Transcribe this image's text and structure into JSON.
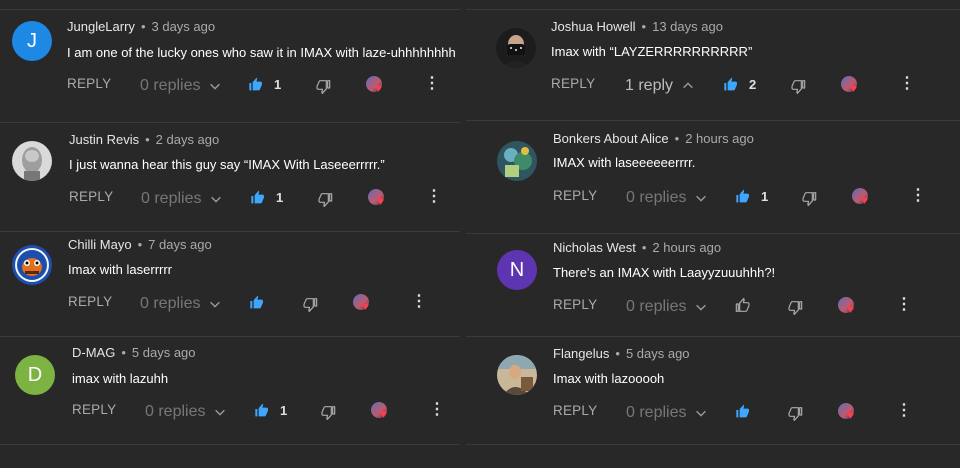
{
  "reply_label": "REPLY",
  "left_comments": [
    {
      "author": "JungleLarry",
      "time": "3 days ago",
      "text": "I am one of the lucky ones who saw it in IMAX with laze-uhhhhhhhh",
      "replies": "0 replies",
      "likes": "1",
      "avatar": {
        "type": "letter",
        "letter": "J",
        "color": "#1e88e5"
      }
    },
    {
      "author": "Justin Revis",
      "time": "2 days ago",
      "text": "I just wanna hear this guy say “IMAX With Laseeerrrrr.”",
      "replies": "0 replies",
      "likes": "1",
      "avatar": {
        "type": "image",
        "color": "#cfcfcf"
      }
    },
    {
      "author": "Chilli Mayo",
      "time": "7 days ago",
      "text": "Imax with laserrrrr",
      "replies": "0 replies",
      "likes": "",
      "avatar": {
        "type": "image",
        "color": "#1a4fb0"
      }
    },
    {
      "author": "D-MAG",
      "time": "5 days ago",
      "text": "imax with lazuhh",
      "replies": "0 replies",
      "likes": "1",
      "avatar": {
        "type": "letter",
        "letter": "D",
        "color": "#7cb342"
      }
    }
  ],
  "right_comments": [
    {
      "author": "Joshua Howell",
      "time": "13 days ago",
      "text": "Imax with “LAYZERRRRRRRRRR”",
      "replies": "1 reply",
      "likes": "2",
      "avatar": {
        "type": "image",
        "color": "#2b2b2b"
      }
    },
    {
      "author": "Bonkers About Alice",
      "time": "2 hours ago",
      "text": "IMAX with laseeeeeerrrr.",
      "replies": "0 replies",
      "likes": "1",
      "avatar": {
        "type": "image",
        "color": "#4a7a8a"
      }
    },
    {
      "author": "Nicholas West",
      "time": "2 hours ago",
      "text": "There's an IMAX with Laayyzuuuhhh?!",
      "replies": "0 replies",
      "likes": "",
      "avatar": {
        "type": "letter",
        "letter": "N",
        "color": "#5e35b1"
      }
    },
    {
      "author": "Flangelus",
      "time": "5 days ago",
      "text": "Imax with lazooooh",
      "replies": "0 replies",
      "likes": "",
      "avatar": {
        "type": "image",
        "color": "#8a6a4a"
      }
    }
  ],
  "colors": {
    "background": "#282828",
    "like_active": "#3ea6ff",
    "like_inactive": "#aaaaaa",
    "heart": "#ff3d4d"
  },
  "icons": {
    "like": "thumb-up-icon",
    "dislike": "thumb-down-icon",
    "heart": "creator-heart-icon",
    "more": "more-vert-icon",
    "chevron_down": "chevron-down-icon",
    "chevron_up": "chevron-up-icon"
  }
}
